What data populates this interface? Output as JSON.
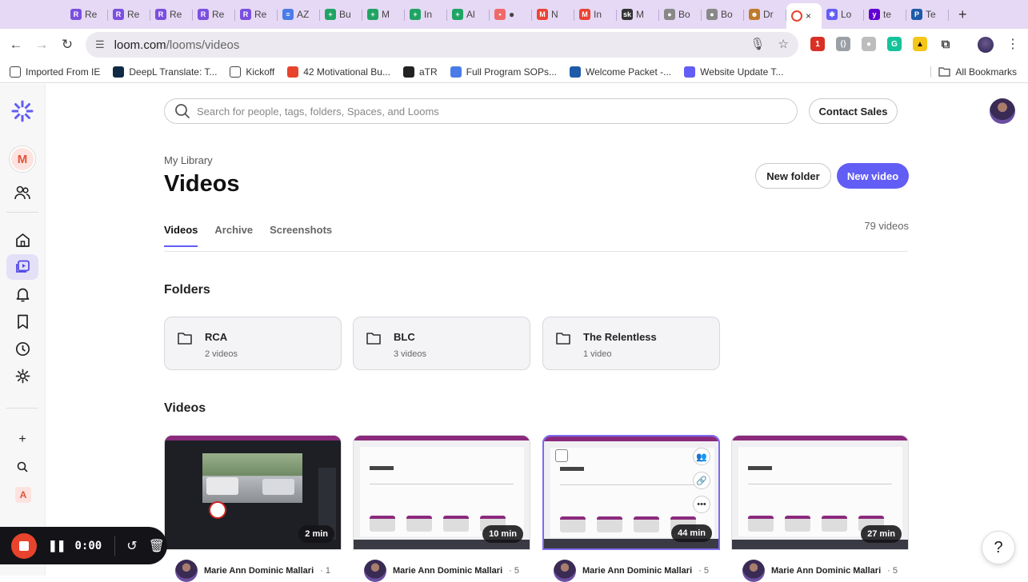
{
  "browser": {
    "tabs": [
      {
        "label": "Re",
        "color": "#7b4fe0",
        "glyph": "R"
      },
      {
        "label": "Re",
        "color": "#7b4fe0",
        "glyph": "R"
      },
      {
        "label": "Re",
        "color": "#7b4fe0",
        "glyph": "R"
      },
      {
        "label": "Re",
        "color": "#7b4fe0",
        "glyph": "R"
      },
      {
        "label": "Re",
        "color": "#7b4fe0",
        "glyph": "R"
      },
      {
        "label": "AZ",
        "color": "#4a7ce8",
        "glyph": "≡"
      },
      {
        "label": "Bu",
        "color": "#1fa463",
        "glyph": "+"
      },
      {
        "label": "M",
        "color": "#1fa463",
        "glyph": "+"
      },
      {
        "label": "In",
        "color": "#1fa463",
        "glyph": "+"
      },
      {
        "label": "Al",
        "color": "#1fa463",
        "glyph": "+"
      },
      {
        "label": "●",
        "color": "#f06a6a",
        "glyph": "•"
      },
      {
        "label": "N",
        "color": "#ea4335",
        "glyph": "M"
      },
      {
        "label": "In",
        "color": "#ea4335",
        "glyph": "M"
      },
      {
        "label": "M",
        "color": "#333333",
        "glyph": "sk"
      },
      {
        "label": "Bo",
        "color": "#888888",
        "glyph": "●"
      },
      {
        "label": "Bo",
        "color": "#888888",
        "glyph": "●"
      },
      {
        "label": "Dr",
        "color": "#c07a2c",
        "glyph": "☻"
      }
    ],
    "active_tab": {
      "label": "",
      "close": "×"
    },
    "tabs_after": [
      {
        "label": "Lo",
        "color": "#625df5",
        "glyph": "✱"
      },
      {
        "label": "te",
        "color": "#6001d2",
        "glyph": "y"
      },
      {
        "label": "Te",
        "color": "#1e5aa8",
        "glyph": "P"
      }
    ],
    "new_tab": "+",
    "url_host": "loom.com",
    "url_path": "/looms/videos",
    "bookmarks": [
      {
        "label": "Imported From IE",
        "icon": "folder-icon",
        "color": "#ffffff"
      },
      {
        "label": "DeepL Translate: T...",
        "icon": "deepl-icon",
        "color": "#0f2b46"
      },
      {
        "label": "Kickoff",
        "icon": "doc-icon",
        "color": "#ffffff"
      },
      {
        "label": "42 Motivational Bu...",
        "icon": "app-icon",
        "color": "#e8432c"
      },
      {
        "label": "aTR",
        "icon": "globe-icon",
        "color": "#222222"
      },
      {
        "label": "Full Program SOPs...",
        "icon": "docs-icon",
        "color": "#4a7ce8"
      },
      {
        "label": "Welcome Packet -...",
        "icon": "form-icon",
        "color": "#1e5aa8"
      },
      {
        "label": "Website Update T...",
        "icon": "loom-icon",
        "color": "#625df5"
      }
    ],
    "all_bookmarks": "All Bookmarks"
  },
  "loom": {
    "search_placeholder": "Search for people, tags, folders, Spaces, and Looms",
    "contact_sales": "Contact Sales",
    "workspace_initial": "M",
    "account_initial": "A",
    "breadcrumb": "My Library",
    "title": "Videos",
    "new_folder": "New folder",
    "new_video": "New video",
    "tabs": [
      "Videos",
      "Archive",
      "Screenshots"
    ],
    "video_count": "79 videos",
    "folders_heading": "Folders",
    "folders": [
      {
        "name": "RCA",
        "count": "2 videos"
      },
      {
        "name": "BLC",
        "count": "3 videos"
      },
      {
        "name": "The Relentless",
        "count": "1 video"
      }
    ],
    "videos_heading": "Videos",
    "videos": [
      {
        "duration": "2 min",
        "owner": "Marie Ann Dominic Mallari",
        "suffix": "1"
      },
      {
        "duration": "10 min",
        "owner": "Marie Ann Dominic Mallari",
        "suffix": "5"
      },
      {
        "duration": "44 min",
        "owner": "Marie Ann Dominic Mallari",
        "suffix": "5"
      },
      {
        "duration": "27 min",
        "owner": "Marie Ann Dominic Mallari",
        "suffix": "5"
      }
    ],
    "accent_color": "#625df5"
  },
  "recorder": {
    "timer": "0:00"
  },
  "help": "?"
}
